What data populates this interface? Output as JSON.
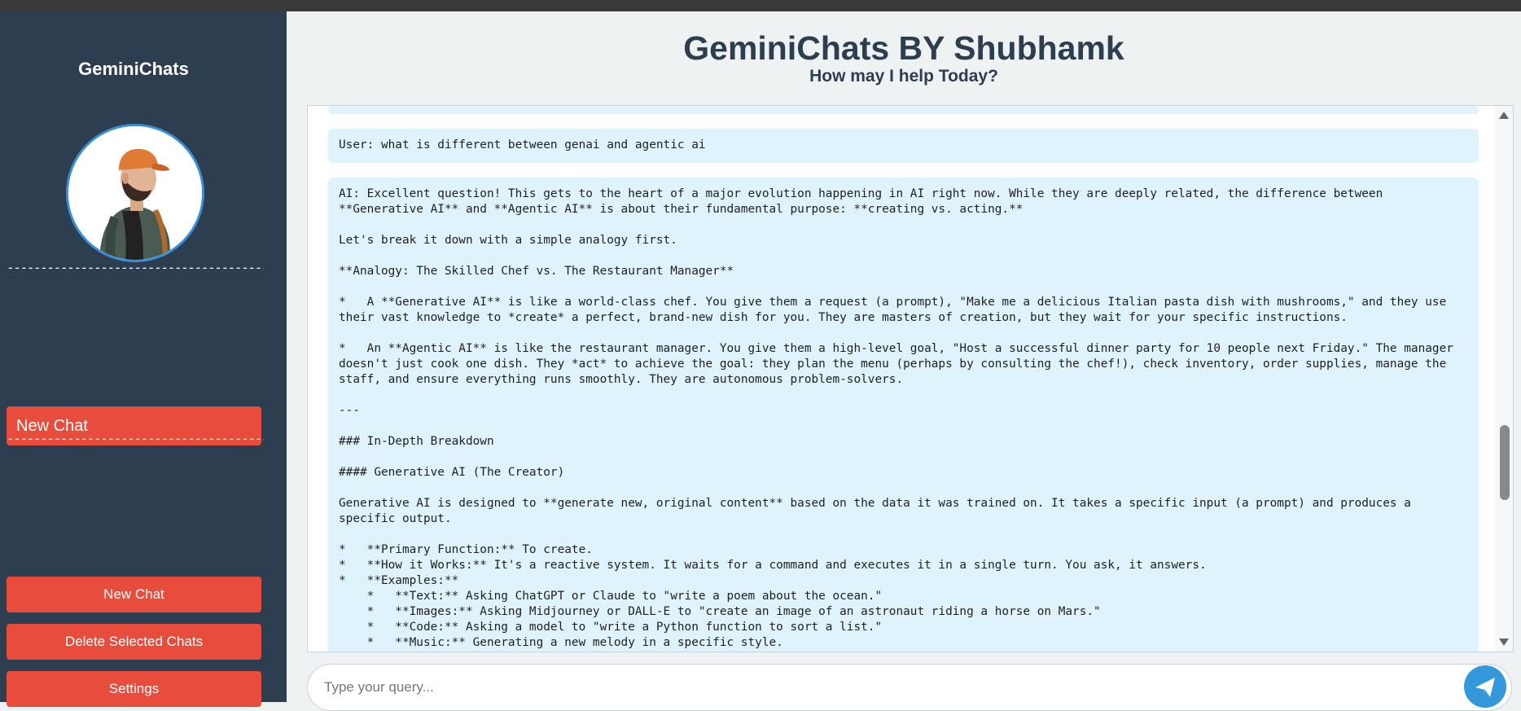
{
  "sidebar": {
    "brand": "GeminiChats",
    "divider_text": "-----------------------------------------------------",
    "new_chat_primary": "New Chat",
    "buttons": {
      "new_chat": "New Chat",
      "delete_selected": "Delete Selected Chats",
      "settings": "Settings"
    }
  },
  "header": {
    "title": "GeminiChats BY Shubhamk",
    "subtitle": "How may I help Today?"
  },
  "chat": {
    "messages": [
      {
        "role": "user",
        "text": "User: what is different between genai and agentic ai"
      },
      {
        "role": "ai",
        "text": "AI: Excellent question! This gets to the heart of a major evolution happening in AI right now. While they are deeply related, the difference between **Generative AI** and **Agentic AI** is about their fundamental purpose: **creating vs. acting.**\n\nLet's break it down with a simple analogy first.\n\n**Analogy: The Skilled Chef vs. The Restaurant Manager**\n\n*   A **Generative AI** is like a world-class chef. You give them a request (a prompt), \"Make me a delicious Italian pasta dish with mushrooms,\" and they use their vast knowledge to *create* a perfect, brand-new dish for you. They are masters of creation, but they wait for your specific instructions.\n\n*   An **Agentic AI** is like the restaurant manager. You give them a high-level goal, \"Host a successful dinner party for 10 people next Friday.\" The manager doesn't just cook one dish. They *act* to achieve the goal: they plan the menu (perhaps by consulting the chef!), check inventory, order supplies, manage the staff, and ensure everything runs smoothly. They are autonomous problem-solvers.\n\n---\n\n### In-Depth Breakdown\n\n#### Generative AI (The Creator)\n\nGenerative AI is designed to **generate new, original content** based on the data it was trained on. It takes a specific input (a prompt) and produces a specific output.\n\n*   **Primary Function:** To create.\n*   **How it Works:** It's a reactive system. It waits for a command and executes it in a single turn. You ask, it answers.\n*   **Examples:**\n    *   **Text:** Asking ChatGPT or Claude to \"write a poem about the ocean.\"\n    *   **Images:** Asking Midjourney or DALL-E to \"create an image of an astronaut riding a horse on Mars.\"\n    *   **Code:** Asking a model to \"write a Python function to sort a list.\"\n    *   **Music:** Generating a new melody in a specific style."
      }
    ]
  },
  "composer": {
    "placeholder": "Type your query..."
  },
  "colors": {
    "sidebar_bg": "#2c3e50",
    "button_red": "#e74c3c",
    "message_bg": "#def3fb",
    "send_blue": "#3498db"
  },
  "icons": {
    "send": "paper-plane-icon",
    "avatar": "user-avatar-illustration"
  }
}
